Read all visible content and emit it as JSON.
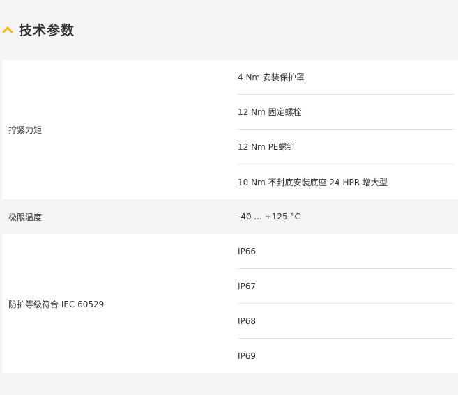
{
  "section": {
    "title": "技术参数",
    "icon": "chevron-up-icon",
    "accent_color": "#f5b800"
  },
  "specs": [
    {
      "label": "拧紧力矩",
      "values": [
        "4 Nm 安装保护罩",
        "12 Nm 固定螺栓",
        "12 Nm PE螺钉",
        "10 Nm 不封底安装底座 24 HPR 增大型"
      ]
    },
    {
      "label": "极限温度",
      "values": [
        "-40 ... +125 °C"
      ]
    },
    {
      "label": "防护等级符合 IEC 60529",
      "values": [
        "IP66",
        "IP67",
        "IP68",
        "IP69"
      ]
    }
  ]
}
